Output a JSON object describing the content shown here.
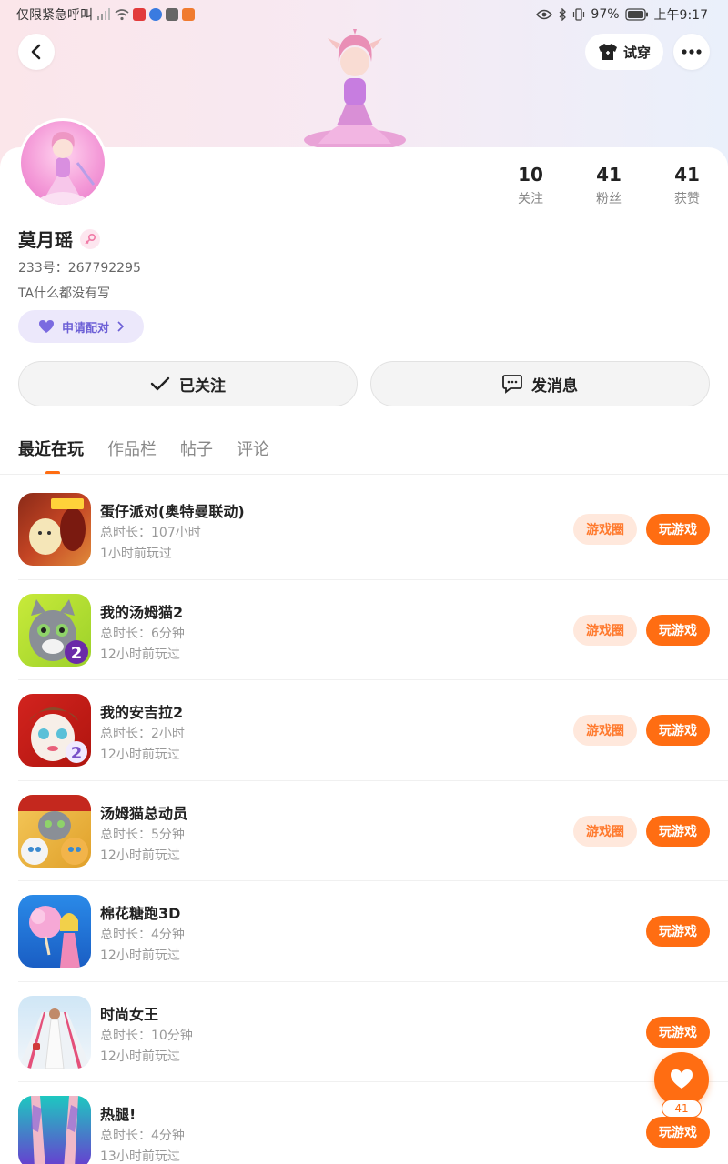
{
  "status_bar": {
    "carrier": "仅限紧急呼叫",
    "battery": "97%",
    "time": "上午9:17"
  },
  "header": {
    "back_icon": "chevron-left-icon",
    "tryon_label": "试穿",
    "more_icon": "more-dots-icon"
  },
  "profile": {
    "name": "莫月瑶",
    "gender": "female",
    "uid_label": "233号：",
    "uid": "267792295",
    "bio": "TA什么都没有写",
    "pair_label": "申请配对"
  },
  "stats": [
    {
      "value": "10",
      "label": "关注"
    },
    {
      "value": "41",
      "label": "粉丝"
    },
    {
      "value": "41",
      "label": "获赞"
    }
  ],
  "actions": {
    "follow_label": "已关注",
    "message_label": "发消息"
  },
  "tabs": [
    {
      "label": "最近在玩",
      "active": true
    },
    {
      "label": "作品栏",
      "active": false
    },
    {
      "label": "帖子",
      "active": false
    },
    {
      "label": "评论",
      "active": false
    }
  ],
  "games": [
    {
      "name": "蛋仔派对(奥特曼联动)",
      "duration": "总时长：107小时",
      "last_played": "1小时前玩过",
      "has_circle": true,
      "circle_label": "游戏圈",
      "play_label": "玩游戏"
    },
    {
      "name": "我的汤姆猫2",
      "duration": "总时长：6分钟",
      "last_played": "12小时前玩过",
      "has_circle": true,
      "circle_label": "游戏圈",
      "play_label": "玩游戏"
    },
    {
      "name": "我的安吉拉2",
      "duration": "总时长：2小时",
      "last_played": "12小时前玩过",
      "has_circle": true,
      "circle_label": "游戏圈",
      "play_label": "玩游戏"
    },
    {
      "name": "汤姆猫总动员",
      "duration": "总时长：5分钟",
      "last_played": "12小时前玩过",
      "has_circle": true,
      "circle_label": "游戏圈",
      "play_label": "玩游戏"
    },
    {
      "name": "棉花糖跑3D",
      "duration": "总时长：4分钟",
      "last_played": "12小时前玩过",
      "has_circle": false,
      "circle_label": "",
      "play_label": "玩游戏"
    },
    {
      "name": "时尚女王",
      "duration": "总时长：10分钟",
      "last_played": "12小时前玩过",
      "has_circle": false,
      "circle_label": "",
      "play_label": "玩游戏"
    },
    {
      "name": "热腿!",
      "duration": "总时长：4分钟",
      "last_played": "13小时前玩过",
      "has_circle": false,
      "circle_label": "",
      "play_label": "玩游戏"
    }
  ],
  "like_fab": {
    "icon": "heart-icon",
    "count": "41"
  },
  "colors": {
    "accent": "#ff6d12",
    "circle_bg": "#ffe8dc",
    "pair_bg": "#ece8fb",
    "pair_text": "#6c5fd6"
  }
}
